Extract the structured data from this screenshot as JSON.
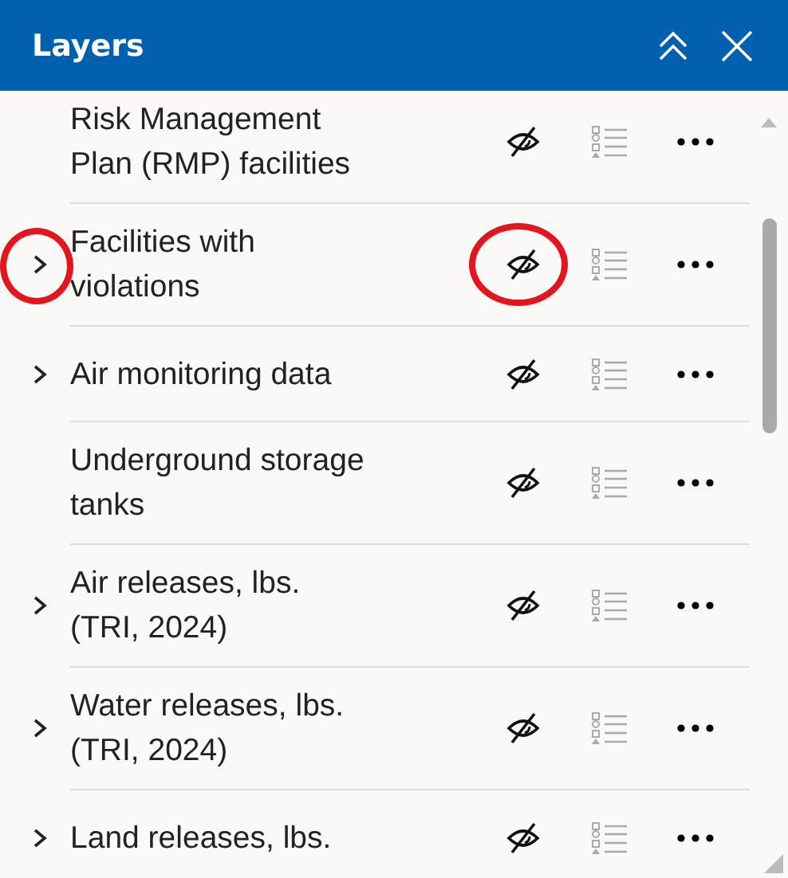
{
  "panel": {
    "title": "Layers"
  },
  "layers": [
    {
      "name": "Risk Management Plan (RMP) facilities",
      "expandable": false,
      "visible": false,
      "expander_highlighted": false,
      "visibility_highlighted": false
    },
    {
      "name": "Facilities with violations",
      "expandable": true,
      "visible": false,
      "expander_highlighted": true,
      "visibility_highlighted": true
    },
    {
      "name": "Air monitoring data",
      "expandable": true,
      "visible": false,
      "expander_highlighted": false,
      "visibility_highlighted": false
    },
    {
      "name": "Underground storage tanks",
      "expandable": false,
      "visible": false,
      "expander_highlighted": false,
      "visibility_highlighted": false
    },
    {
      "name": "Air releases, lbs. (TRI, 2024)",
      "expandable": true,
      "visible": false,
      "expander_highlighted": false,
      "visibility_highlighted": false
    },
    {
      "name": "Water releases, lbs. (TRI, 2024)",
      "expandable": true,
      "visible": false,
      "expander_highlighted": false,
      "visibility_highlighted": false
    },
    {
      "name": "Land releases, lbs.",
      "expandable": true,
      "visible": false,
      "expander_highlighted": false,
      "visibility_highlighted": false
    }
  ]
}
